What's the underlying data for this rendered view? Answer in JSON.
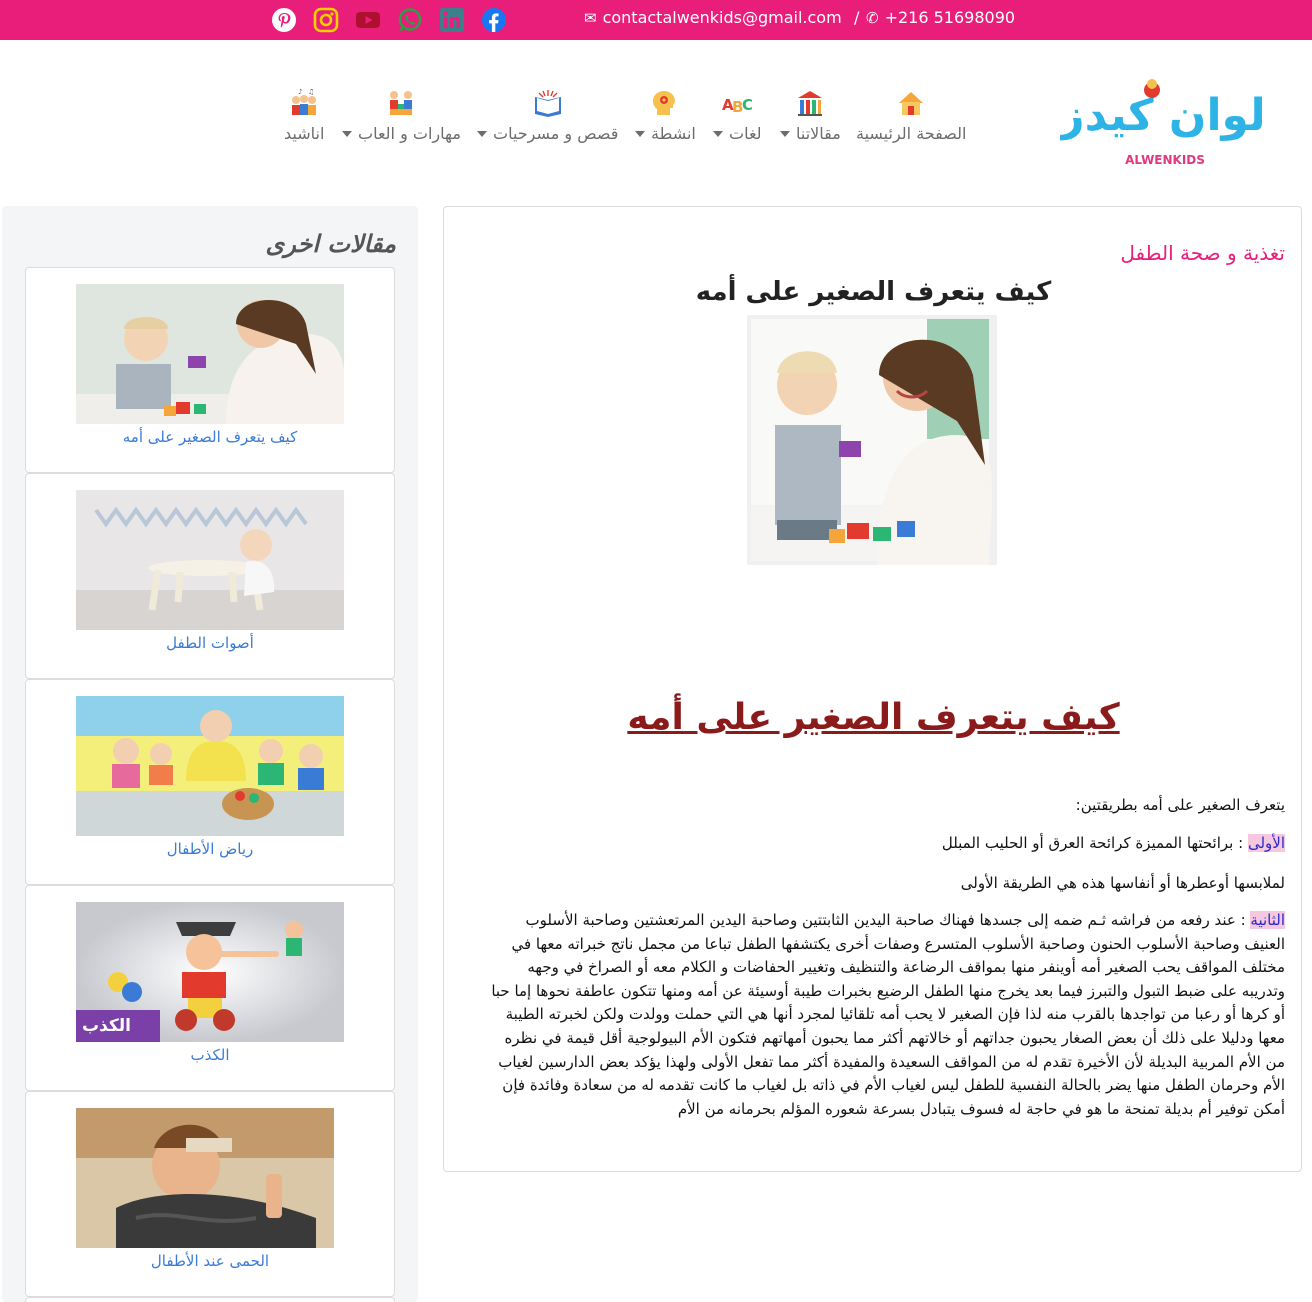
{
  "topbar": {
    "email": "contactalwenkids@gmail.com",
    "separator": "/",
    "phone": "+216 51698090",
    "social_icons": [
      "pinterest-icon",
      "instagram-icon",
      "youtube-icon",
      "whatsapp-icon",
      "linkedin-icon",
      "facebook-icon"
    ],
    "colors": {
      "bar": "#e91e7b"
    }
  },
  "logo": {
    "arabic": "ألوان كيدز",
    "latin": "ALWENKIDS"
  },
  "nav": [
    {
      "label": "الصفحة الرئيسية",
      "icon": "home-icon",
      "dropdown": false
    },
    {
      "label": "مقالاتنا",
      "icon": "bar-chart-icon",
      "dropdown": true
    },
    {
      "label": "لغات",
      "icon": "abc-icon",
      "dropdown": true
    },
    {
      "label": "انشطة",
      "icon": "head-gear-icon",
      "dropdown": true
    },
    {
      "label": "قصص و مسرحيات",
      "icon": "open-book-icon",
      "dropdown": true
    },
    {
      "label": "مهارات و العاب",
      "icon": "kids-playing-icon",
      "dropdown": true
    },
    {
      "label": "اناشيد",
      "icon": "singing-kids-icon",
      "dropdown": false
    }
  ],
  "sidebar": {
    "title": "مقالات اخرى",
    "items": [
      {
        "caption": "كيف يتعرف الصغير على أمه"
      },
      {
        "caption": "أصوات الطفل"
      },
      {
        "caption": "رياض الأطفال"
      },
      {
        "caption": "الكذب",
        "image_text": "الكذب"
      },
      {
        "caption": "الحمى عند الأطفال"
      }
    ]
  },
  "article": {
    "category": "تغذية و صحة الطفل",
    "title": "كيف يتعرف الصغير على أمه",
    "heading": "كيف يتعرف الصغير على أمه",
    "intro": "يتعرف الصغير على أمه بطريقتين:",
    "first_label": "الأولى",
    "first_text": " : برائحتها المميزة كرائحة العرق أو الحليب المبلل",
    "first_text_2": "لملابسها أوعطرها أو أنفاسها هذه هي الطريقة الأولى",
    "second_label": "الثانية",
    "second_text": " : عند رفعه من فراشه ثـم ضمه إلى جسدها فهناك صاحبة اليدين الثابتتين وصاحبة اليدين المرتعشتين وصاحبة الأسلوب العنيف وصاحبة الأسلوب الحنون وصاحبة الأسلوب المتسرع وصفات أخرى يكتشفها الطفل تباعا من مجمل ناتج خبراته معها في مختلف المواقف يحب الصغير أمه أوينفر منها بمواقف الرضاعة والتنظيف وتغيير الحفاضات و الكلام معه أو الصراخ في وجهه وتدريبه على ضبط التبول والتبرز فيما بعد يخرج منها الطفل الرضيع بخبرات طيبة أوسيئة عن أمه ومنها تتكون عاطفة نحوها إما حبا أو كرها أو رعبا من تواجدها بالقرب منه لذا فإن الصغير لا يحب أمه تلقائيا لمجرد أنها هي التي  حملت وولدت ولكن لخبرته الطيبة معها ودليلا على ذلك أن بعض الصغار يحبون جداتهم أو خالاتهم أكثر مما يحبون أمهاتهم فتكون الأم البيولوجية أقل قيمة في نظره من الأم المربية البديلة لأن الأخيرة تقدم له من المواقف السعيدة والمفيدة أكثر مما تفعل الأولى ولهذا يؤكد بعض الدارسين لغياب الأم وحرمان الطفل منها يضر بالحالة النفسية للطفل ليس لغياب الأم في ذاته بل لغياب ما كانت تقدمه له من سعادة وفائدة فإن أمكن توفير أم بديلة تمنحة ما هو في حاجة له فسوف يتبادل بسرعة شعوره المؤلم بحرمانه من الأم",
    "colors": {
      "category": "#e91e7b",
      "heading": "#8b1a1a",
      "highlight_bg": "#f6c8e0",
      "highlight_text": "#2929c8",
      "link": "#3a7bd5"
    }
  }
}
